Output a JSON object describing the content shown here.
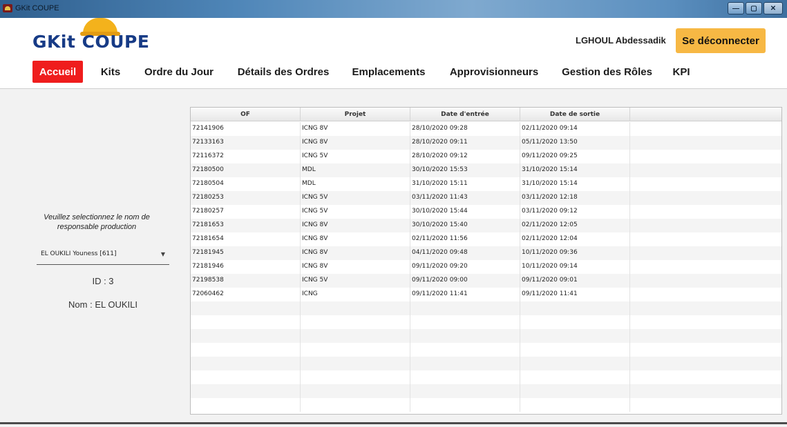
{
  "window": {
    "title": "GKit COUPE"
  },
  "header": {
    "logo": "GKit COUPE",
    "username": "LGHOUL Abdessadik",
    "logout_label": "Se déconnecter",
    "nav": [
      {
        "label": "Accueil",
        "active": true
      },
      {
        "label": "Kits"
      },
      {
        "label": "Ordre du Jour"
      },
      {
        "label": "Détails des Ordres"
      },
      {
        "label": "Emplacements"
      },
      {
        "label": "Approvisionneurs"
      },
      {
        "label": "Gestion des Rôles"
      },
      {
        "label": "KPI"
      }
    ]
  },
  "left_panel": {
    "prompt": "Veuillez selectionnez le nom de responsable production",
    "selected_responsable": "EL OUKILI Youness [611]",
    "id_text": "ID : 3",
    "name_text": "Nom : EL OUKILI"
  },
  "table": {
    "columns": [
      "OF",
      "Projet",
      "Date d'entrée",
      "Date de sortie"
    ],
    "rows": [
      [
        "72141906",
        "ICNG 8V",
        "28/10/2020  09:28",
        "02/11/2020  09:14"
      ],
      [
        "72133163",
        "ICNG 8V",
        "28/10/2020  09:11",
        "05/11/2020  13:50"
      ],
      [
        "72116372",
        "ICNG 5V",
        "28/10/2020  09:12",
        "09/11/2020  09:25"
      ],
      [
        "72180500",
        "MDL",
        "30/10/2020  15:53",
        "31/10/2020  15:14"
      ],
      [
        "72180504",
        "MDL",
        "31/10/2020  15:11",
        "31/10/2020  15:14"
      ],
      [
        "72180253",
        "ICNG 5V",
        "03/11/2020  11:43",
        "03/11/2020  12:18"
      ],
      [
        "72180257",
        "ICNG 5V",
        "30/10/2020  15:44",
        "03/11/2020  09:12"
      ],
      [
        "72181653",
        "ICNG 8V",
        "30/10/2020  15:40",
        "02/11/2020  12:05"
      ],
      [
        "72181654",
        "ICNG 8V",
        "02/11/2020  11:56",
        "02/11/2020  12:04"
      ],
      [
        "72181945",
        "ICNG 8V",
        "04/11/2020  09:48",
        "10/11/2020  09:36"
      ],
      [
        "72181946",
        "ICNG 8V",
        "09/11/2020  09:20",
        "10/11/2020  09:14"
      ],
      [
        "72198538",
        "ICNG 5V",
        "09/11/2020  09:00",
        "09/11/2020  09:01"
      ],
      [
        "72060462",
        "ICNG",
        "09/11/2020  11:41",
        "09/11/2020  11:41"
      ]
    ]
  },
  "colors": {
    "accent_active": "#ef1d1d",
    "logout_button": "#f7b844",
    "logo_blue": "#173b86"
  }
}
